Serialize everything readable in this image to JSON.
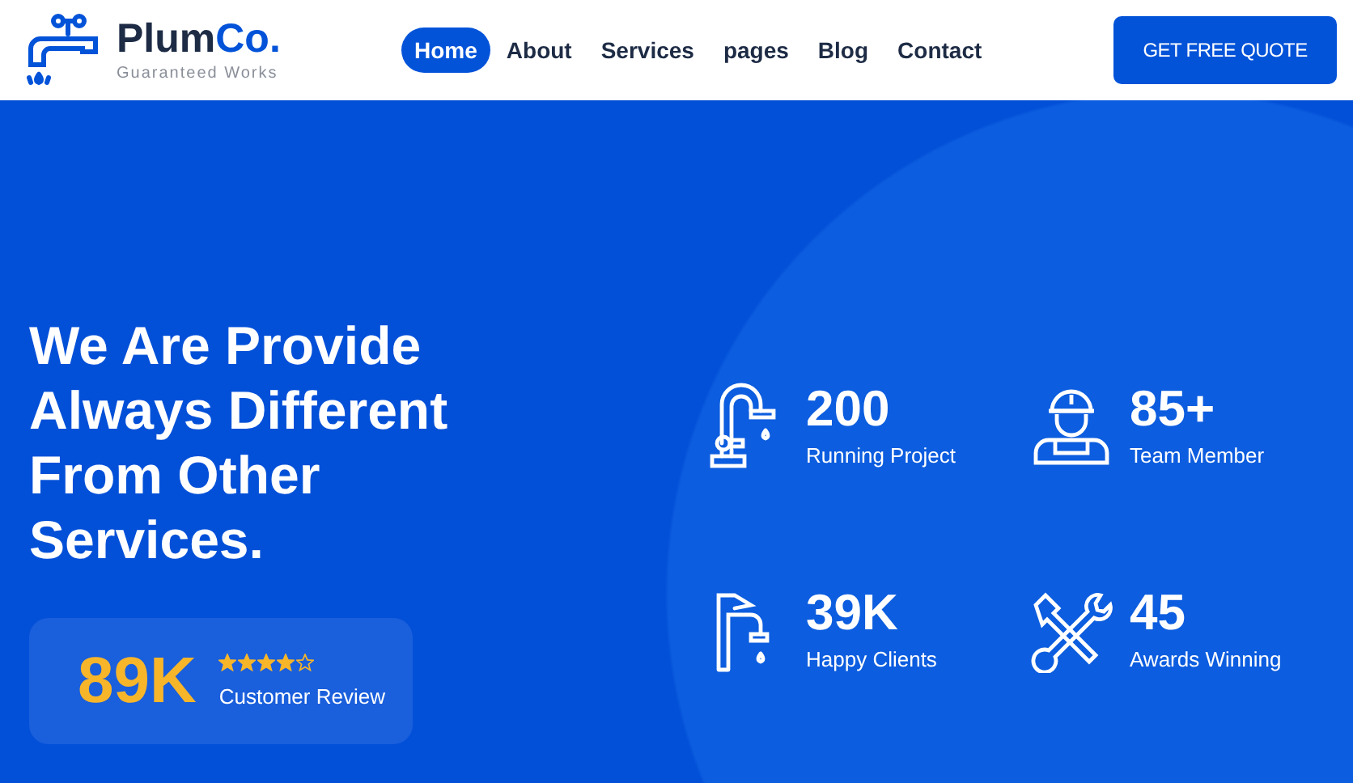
{
  "logo": {
    "name_main": "Plum",
    "name_accent": "Co.",
    "tagline": "Guaranteed Works"
  },
  "nav": [
    {
      "label": "Home",
      "selected": true
    },
    {
      "label": "About",
      "selected": false
    },
    {
      "label": "Services",
      "selected": false
    },
    {
      "label": "pages",
      "selected": false
    },
    {
      "label": "Blog",
      "selected": false
    },
    {
      "label": "Contact",
      "selected": false
    }
  ],
  "cta_button": "GET FREE QUOTE",
  "hero": {
    "heading": "We Are Provide Always Different From Other Services.",
    "review": {
      "count": "89K",
      "stars": 4,
      "label": "Customer Review"
    }
  },
  "stats": [
    {
      "kind": "tap",
      "value": "200",
      "label": "Running Project"
    },
    {
      "kind": "worker",
      "value": "85+",
      "label": "Team Member"
    },
    {
      "kind": "faucet",
      "value": "39K",
      "label": "Happy Clients"
    },
    {
      "kind": "tools",
      "value": "45",
      "label": "Awards Winning"
    }
  ]
}
